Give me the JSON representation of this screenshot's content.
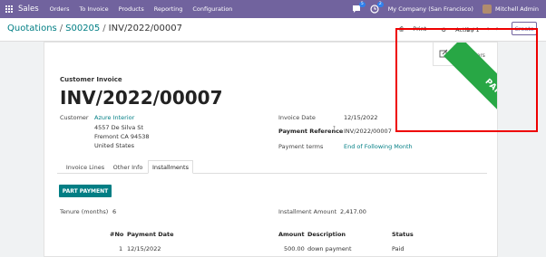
{
  "navbar": {
    "brand": "Sales",
    "menus": [
      "Orders",
      "To Invoice",
      "Products",
      "Reporting",
      "Configuration"
    ],
    "chat_count": "5",
    "activity_count": "2",
    "company": "My Company (San Francisco)",
    "user": "Mitchell Admin"
  },
  "breadcrumb": {
    "root": "Quotations",
    "parent": "S00205",
    "current": "INV/2022/00007"
  },
  "toolbar": {
    "print": "Print",
    "action": "Action",
    "pager": "1 / 1",
    "create": "Create"
  },
  "smart_button": {
    "count": "1",
    "label": "Sale Orders"
  },
  "ribbon": "PARTIAL",
  "invoice": {
    "type": "Customer Invoice",
    "number": "INV/2022/00007",
    "customer_label": "Customer",
    "customer_name": "Azure Interior",
    "address_line1": "4557 De Silva St",
    "address_line2": "Fremont CA 94538",
    "address_line3": "United States",
    "date_label": "Invoice Date",
    "date_value": "12/15/2022",
    "ref_label": "Payment Reference",
    "ref_tooltip": "?",
    "ref_value": "INV/2022/00007",
    "terms_label": "Payment terms",
    "terms_value": "End of Following Month"
  },
  "tabs": [
    "Invoice Lines",
    "Other Info",
    "Installments"
  ],
  "installments": {
    "button": "PART PAYMENT",
    "tenure_label": "Tenure (months)",
    "tenure_value": "6",
    "amount_label": "Installment Amount",
    "amount_value": "2,417.00",
    "columns": [
      "#No",
      "Payment Date",
      "Amount",
      "Description",
      "Status"
    ],
    "rows": [
      [
        "1",
        "12/15/2022",
        "500.00",
        "down payment",
        "Paid"
      ]
    ]
  },
  "colors": {
    "navbar": "#71639e",
    "accent": "#017e84",
    "ribbon": "#28a745",
    "highlight": "#ee0000"
  }
}
